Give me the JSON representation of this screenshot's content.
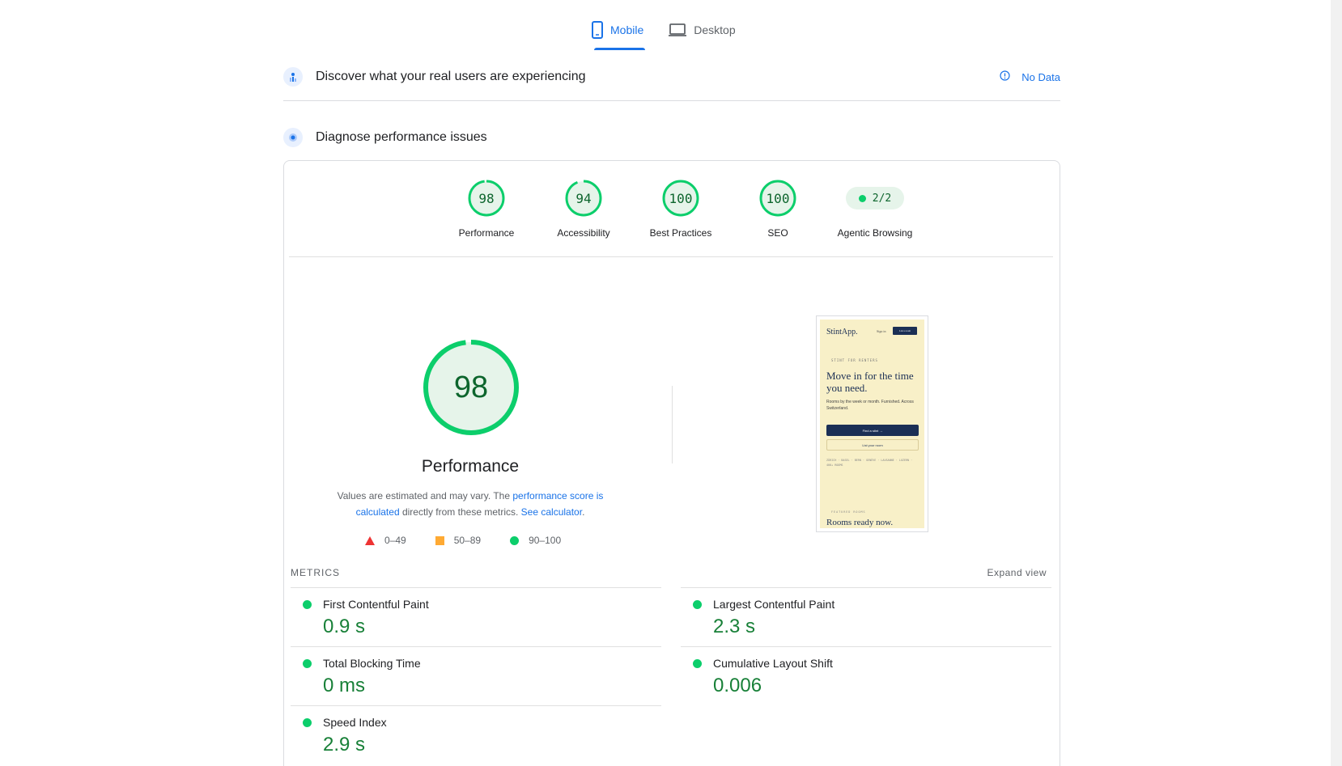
{
  "tabs": [
    {
      "label": "Mobile",
      "icon": "phone-icon",
      "active": true
    },
    {
      "label": "Desktop",
      "icon": "laptop-icon",
      "active": false
    }
  ],
  "field_section": {
    "title": "Discover what your real users are experiencing",
    "status": "No Data"
  },
  "lab_section": {
    "title": "Diagnose performance issues"
  },
  "categories": [
    {
      "score": "98",
      "label": "Performance",
      "value": 98
    },
    {
      "score": "94",
      "label": "Accessibility",
      "value": 94
    },
    {
      "score": "100",
      "label": "Best Practices",
      "value": 100
    },
    {
      "score": "100",
      "label": "SEO",
      "value": 100
    },
    {
      "score": "2/2",
      "label": "Agentic Browsing"
    }
  ],
  "performance": {
    "score": "98",
    "value": 98,
    "title": "Performance",
    "desc_start": "Values are estimated and may vary. The ",
    "desc_link1": "performance score is calculated",
    "desc_mid": " directly from these metrics. ",
    "desc_link2": "See calculator",
    "desc_end": "."
  },
  "legend": [
    "0–49",
    "50–89",
    "90–100"
  ],
  "screenshot": {
    "logo": "StintApp.",
    "sign_in": "Sign in",
    "cta_small": "List a room",
    "kicker": "STINT FOR RENTERS",
    "headline": "Move in for the time you need.",
    "sub": "Rooms by the week or month. Furnished. Across Switzerland.",
    "primary": "Find a stint →",
    "secondary": "List your room",
    "mono": "ZÜRICH · BASEL · BERN · GENÈVE · LAUSANNE · LUZERN · 400+ ROOMS",
    "label": "FEATURED ROOMS",
    "footer": "Rooms ready now."
  },
  "metrics_header": "METRICS",
  "expand_label": "Expand view",
  "metrics": [
    {
      "label": "First Contentful Paint",
      "value": "0.9 s"
    },
    {
      "label": "Largest Contentful Paint",
      "value": "2.3 s"
    },
    {
      "label": "Total Blocking Time",
      "value": "0 ms"
    },
    {
      "label": "Cumulative Layout Shift",
      "value": "0.006"
    },
    {
      "label": "Speed Index",
      "value": "2.9 s"
    }
  ],
  "colors": {
    "accent": "#1a73e8",
    "pass": "#0cce6b",
    "pass_text": "#0d652d",
    "metric_value": "#188038",
    "average": "#ffaa33",
    "fail": "#ee3333"
  }
}
